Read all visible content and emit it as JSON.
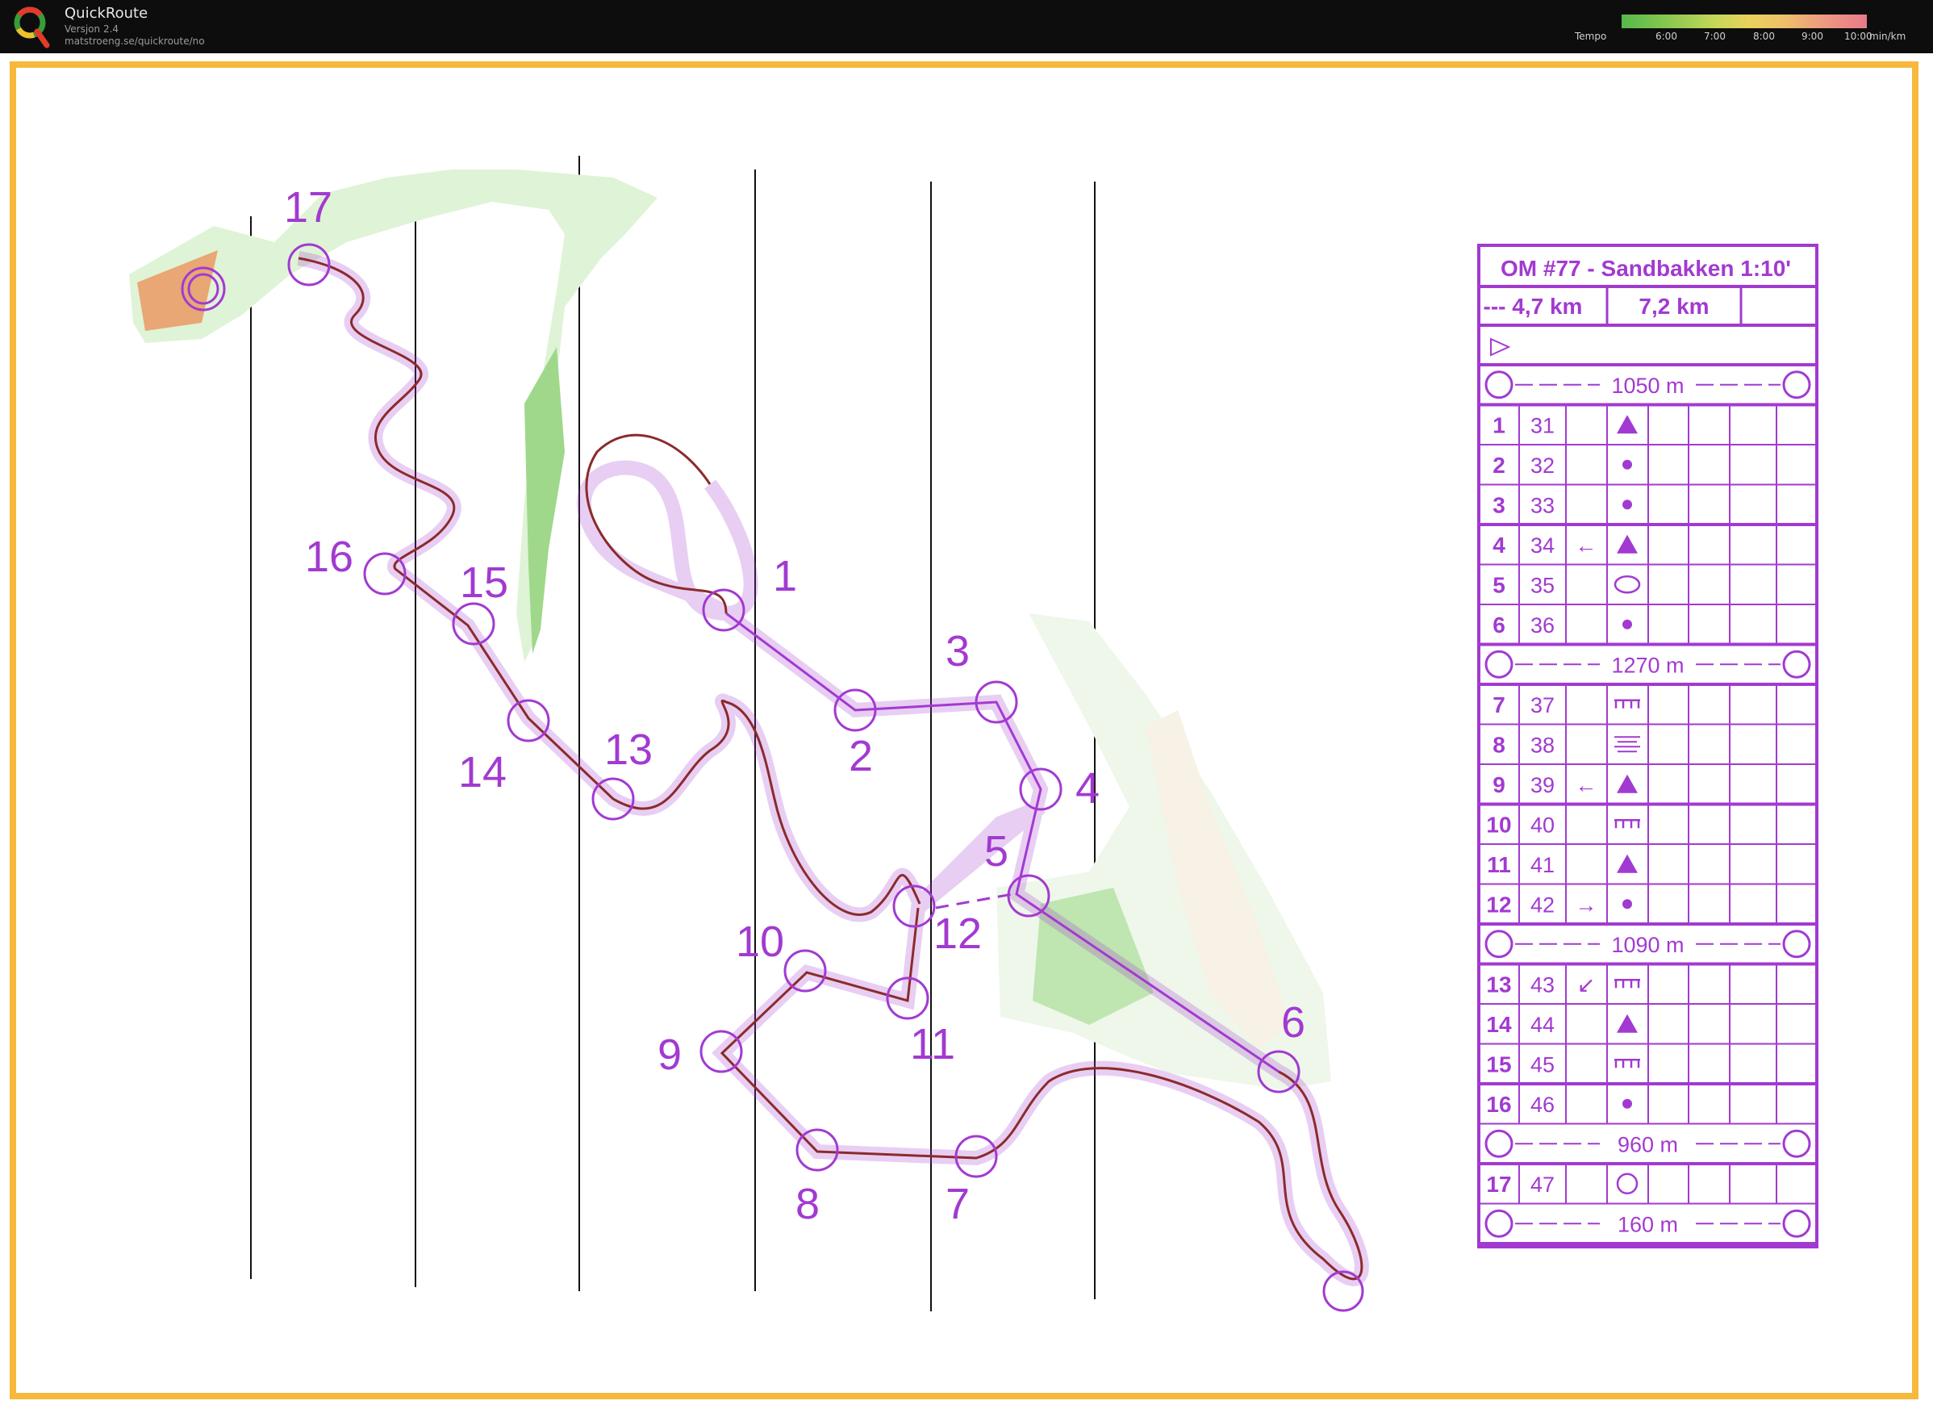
{
  "app": {
    "title": "QuickRoute",
    "version": "Versjon 2.4",
    "url": "matstroeng.se/quickroute/no",
    "logo_letter": "Q"
  },
  "tempo": {
    "label": "Tempo",
    "ticks": [
      "6:00",
      "7:00",
      "8:00",
      "9:00",
      "10:00"
    ],
    "unit": "min/km"
  },
  "colors": {
    "course": "#a23ad1",
    "route": "#8b2b2b",
    "frame": "#f6b93b",
    "topbar": "#0d0d0d"
  },
  "map": {
    "control_labels": [
      "1",
      "2",
      "3",
      "4",
      "5",
      "6",
      "7",
      "8",
      "9",
      "10",
      "11",
      "12",
      "13",
      "14",
      "15",
      "16",
      "17"
    ]
  },
  "description_sheet": {
    "title": "OM #77 - Sandbakken 1:10'",
    "distance_left": "--- 4,7 km",
    "distance_right": "7,2 km",
    "legs": [
      "1050 m",
      "1270 m",
      "1090 m",
      "960 m",
      "160 m"
    ],
    "controls": [
      {
        "no": "1",
        "code": "31",
        "direction": "",
        "symbol": "triangle"
      },
      {
        "no": "2",
        "code": "32",
        "direction": "",
        "symbol": "dot"
      },
      {
        "no": "3",
        "code": "33",
        "direction": "",
        "symbol": "dot"
      },
      {
        "no": "4",
        "code": "34",
        "direction": "←",
        "symbol": "triangle"
      },
      {
        "no": "5",
        "code": "35",
        "direction": "",
        "symbol": "ellipse"
      },
      {
        "no": "6",
        "code": "36",
        "direction": "",
        "symbol": "dot"
      },
      {
        "no": "7",
        "code": "37",
        "direction": "",
        "symbol": "bank"
      },
      {
        "no": "8",
        "code": "38",
        "direction": "",
        "symbol": "lines"
      },
      {
        "no": "9",
        "code": "39",
        "direction": "←",
        "symbol": "triangle"
      },
      {
        "no": "10",
        "code": "40",
        "direction": "",
        "symbol": "bank"
      },
      {
        "no": "11",
        "code": "41",
        "direction": "",
        "symbol": "triangle"
      },
      {
        "no": "12",
        "code": "42",
        "direction": "→",
        "symbol": "dot"
      },
      {
        "no": "13",
        "code": "43",
        "direction": "↙",
        "symbol": "bank"
      },
      {
        "no": "14",
        "code": "44",
        "direction": "",
        "symbol": "triangle"
      },
      {
        "no": "15",
        "code": "45",
        "direction": "",
        "symbol": "bank"
      },
      {
        "no": "16",
        "code": "46",
        "direction": "",
        "symbol": "dot"
      },
      {
        "no": "17",
        "code": "47",
        "direction": "",
        "symbol": "feature"
      }
    ]
  }
}
